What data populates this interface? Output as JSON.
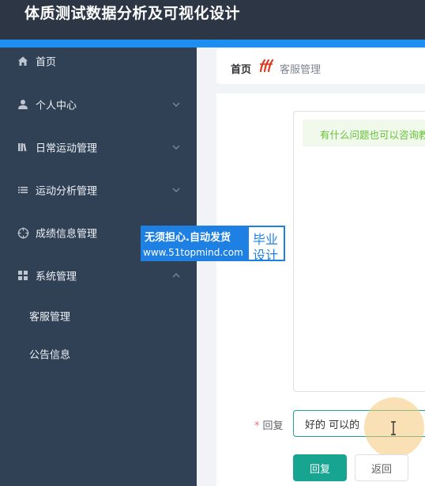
{
  "header": {
    "title": "体质测试数据分析及可视化设计"
  },
  "sidebar": {
    "items": [
      {
        "label": "首页",
        "icon": "home-icon"
      },
      {
        "label": "个人中心",
        "icon": "user-icon"
      },
      {
        "label": "日常运动管理",
        "icon": "library-icon"
      },
      {
        "label": "运动分析管理",
        "icon": "list-icon"
      },
      {
        "label": "成绩信息管理",
        "icon": "crosshair-icon"
      },
      {
        "label": "系统管理",
        "icon": "grid-icon"
      }
    ],
    "sub_items": [
      {
        "label": "客服管理"
      },
      {
        "label": "公告信息"
      }
    ]
  },
  "breadcrumb": {
    "home": "首页",
    "current": "客服管理"
  },
  "chat": {
    "message": "有什么问题也可以咨询教"
  },
  "form": {
    "reply_label": "回复",
    "required_mark": "*",
    "reply_value": "好的 可以的",
    "reply_button": "回复",
    "back_button": "返回"
  },
  "watermark": {
    "line1": "无须担心.自动发货",
    "line2": "www.51topmind.com",
    "badge_line1": "毕业",
    "badge_line2": "设计"
  },
  "colors": {
    "header_bg": "#2c3645",
    "accent_blue": "#1e8ef0",
    "sidebar_bg": "#304156",
    "primary_button": "#17a592",
    "message_bg": "#f0f9eb",
    "message_text": "#67c23a"
  }
}
